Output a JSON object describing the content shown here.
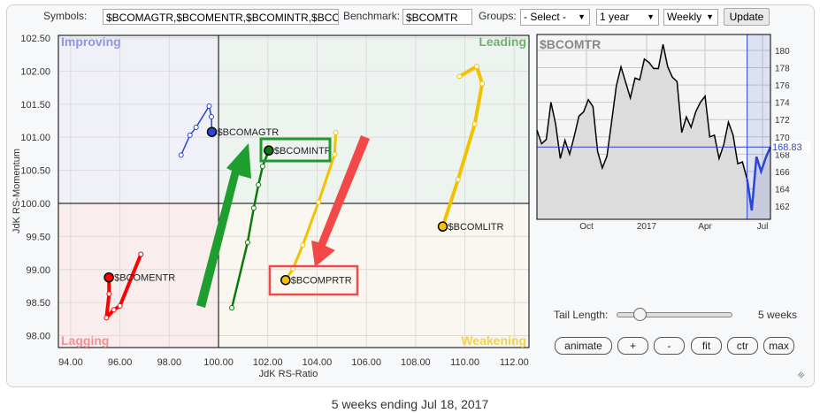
{
  "toolbar": {
    "symbols_label": "Symbols:",
    "symbols_value": "$BCOMAGTR,$BCOMENTR,$BCOMINTR,$BCOM",
    "benchmark_label": "Benchmark:",
    "benchmark_value": "$BCOMTR",
    "groups_label": "Groups:",
    "groups_value": "- Select -",
    "period_value": "1 year",
    "interval_value": "Weekly",
    "update_label": "Update"
  },
  "controls": {
    "tail_label": "Tail Length:",
    "tail_value": "5 weeks",
    "tail_fraction": 0.2,
    "buttons": [
      "animate",
      "+",
      "-",
      "fit",
      "ctr",
      "max"
    ]
  },
  "caption": "5 weeks ending Jul 18, 2017",
  "chart_data": [
    {
      "type": "scatter",
      "title": "Relative Rotation Graph",
      "xlabel": "JdK RS-Ratio",
      "ylabel": "JdK RS-Momentum",
      "xlim": [
        93.5,
        112.6
      ],
      "ylim": [
        97.82,
        102.54
      ],
      "xticks": [
        "94.00",
        "96.00",
        "98.00",
        "100.00",
        "102.00",
        "104.00",
        "106.00",
        "108.00",
        "110.00",
        "112.00"
      ],
      "yticks": [
        "102.50",
        "102.00",
        "101.50",
        "101.00",
        "100.50",
        "100.00",
        "99.50",
        "99.00",
        "98.50",
        "98.00"
      ],
      "quadrants": {
        "top_left": "Improving",
        "top_right": "Leading",
        "bottom_left": "Lagging",
        "bottom_right": "Weakening"
      },
      "series": [
        {
          "name": "$BCOMAGTR",
          "color": "#2a45d6",
          "x": [
            98.48,
            98.84,
            99.09,
            99.62,
            99.71,
            99.73
          ],
          "y": [
            100.73,
            101.03,
            101.15,
            101.47,
            101.31,
            101.08
          ]
        },
        {
          "name": "$BCOMENTR",
          "color": "#ff0000",
          "x": [
            96.85,
            96.0,
            95.75,
            95.45,
            95.56,
            95.55
          ],
          "y": [
            99.23,
            98.45,
            98.39,
            98.27,
            98.63,
            98.88
          ]
        },
        {
          "name": "$BCOMINTR",
          "color": "#0a7a0a",
          "x": [
            100.54,
            101.18,
            101.43,
            101.62,
            101.79,
            102.04
          ],
          "y": [
            98.42,
            99.41,
            99.93,
            100.28,
            100.56,
            100.8
          ]
        },
        {
          "name": "$BCOMPRTR",
          "color": "#f2c200",
          "x": [
            104.76,
            104.71,
            104.06,
            103.42,
            103.02,
            102.72
          ],
          "y": [
            101.07,
            100.74,
            100.02,
            99.37,
            99.01,
            98.84
          ]
        },
        {
          "name": "$BCOMLITR",
          "color": "#f2c200",
          "x": [
            109.78,
            110.48,
            110.7,
            110.4,
            109.72,
            109.1
          ],
          "y": [
            101.92,
            102.07,
            101.81,
            101.2,
            100.36,
            99.65
          ]
        }
      ]
    },
    {
      "type": "line",
      "title": "$BCOMTR",
      "ylim": [
        160.5,
        182
      ],
      "yticks": [
        "180",
        "178",
        "176",
        "174",
        "172",
        "170",
        "168",
        "166",
        "164",
        "162"
      ],
      "xticks": [
        "Oct",
        "2017",
        "Apr",
        "Jul"
      ],
      "last_value": "168.83",
      "highlight_last_n": 5,
      "values": [
        170.8,
        169.2,
        169.7,
        174.0,
        171.5,
        167.5,
        169.6,
        168.0,
        170.1,
        172.4,
        172.9,
        174.3,
        173.5,
        168.3,
        166.4,
        167.8,
        171.8,
        175.9,
        178.1,
        176.3,
        174.5,
        176.8,
        176.6,
        179.0,
        178.6,
        177.9,
        177.9,
        180.7,
        178.1,
        176.9,
        176.4,
        170.5,
        172.3,
        171.1,
        172.9,
        174.0,
        174.7,
        170.0,
        170.2,
        167.5,
        169.1,
        171.7,
        170.2,
        166.9,
        167.1,
        165.1,
        161.5,
        167.7,
        166.0,
        167.6,
        168.83
      ]
    }
  ]
}
